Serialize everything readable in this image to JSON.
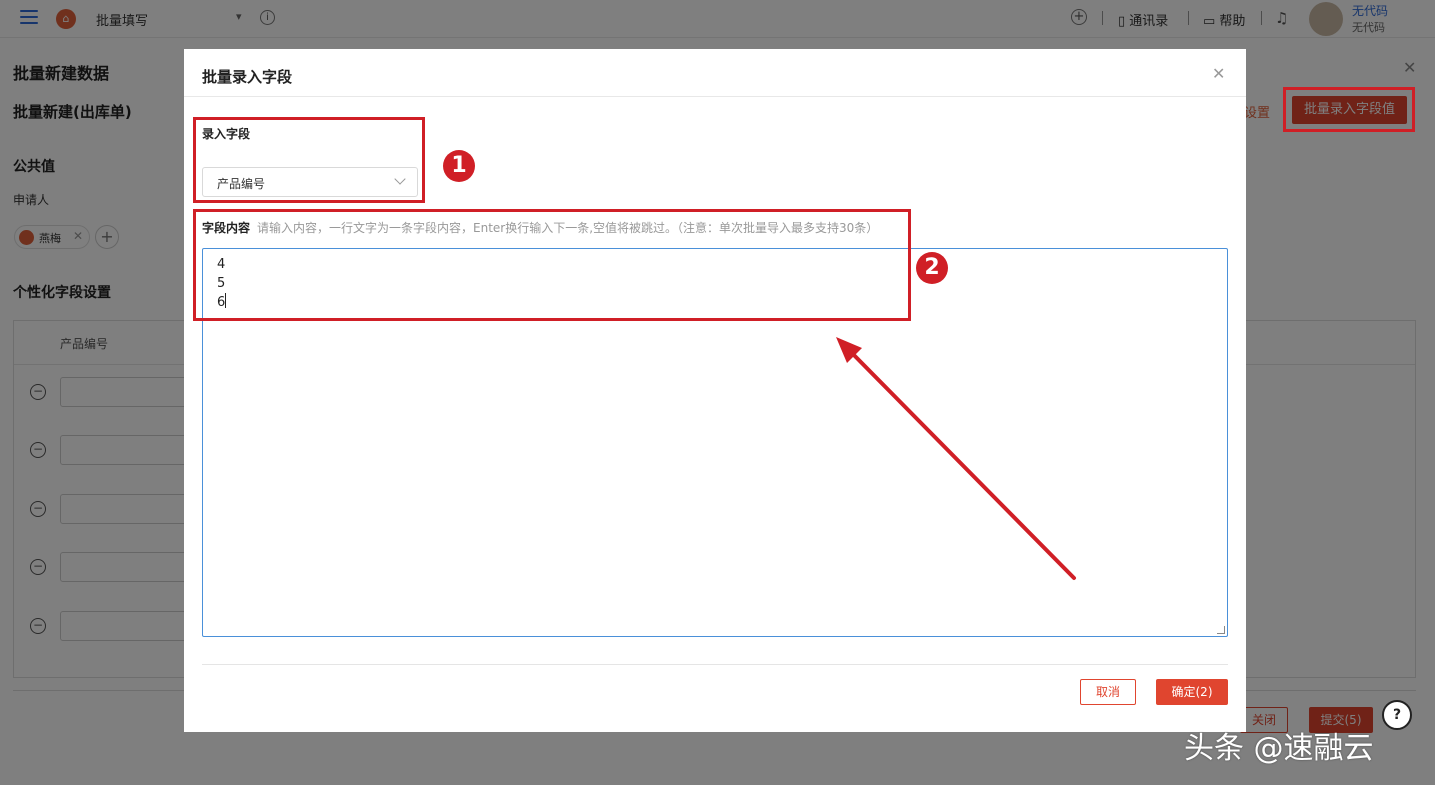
{
  "topbar": {
    "app_name": "批量填写",
    "contacts_label": "通讯录",
    "help_label": "帮助",
    "user_name": "无代码",
    "user_sub": "无代码"
  },
  "background": {
    "panel_title": "批量新建数据",
    "sub_title": "批量新建(出库单)",
    "settings_link": "设置",
    "batch_button": "批量录入字段值",
    "public_section": "公共值",
    "applicant_label": "申请人",
    "applicant_tag": "燕梅",
    "personal_section": "个性化字段设置",
    "table_column": "产品编号",
    "close_button": "关闭",
    "submit_button": "提交(5)"
  },
  "modal": {
    "title": "批量录入字段",
    "field_label": "录入字段",
    "field_value": "产品编号",
    "content_label": "字段内容",
    "content_hint": "请输入内容，一行文字为一条字段内容，Enter换行输入下一条,空值将被跳过。（注意：单次批量导入最多支持30条）",
    "content_lines": [
      "4",
      "5",
      "6"
    ],
    "cancel_button": "取消",
    "confirm_button": "确定(2)"
  },
  "annotations": {
    "step1": "1",
    "step2": "2",
    "color": "#d01f26"
  },
  "watermark": "头条 @速融云",
  "colors": {
    "accent": "#e0452f",
    "focus_border": "#4a90d9",
    "link_blue": "#2f6bd8"
  }
}
